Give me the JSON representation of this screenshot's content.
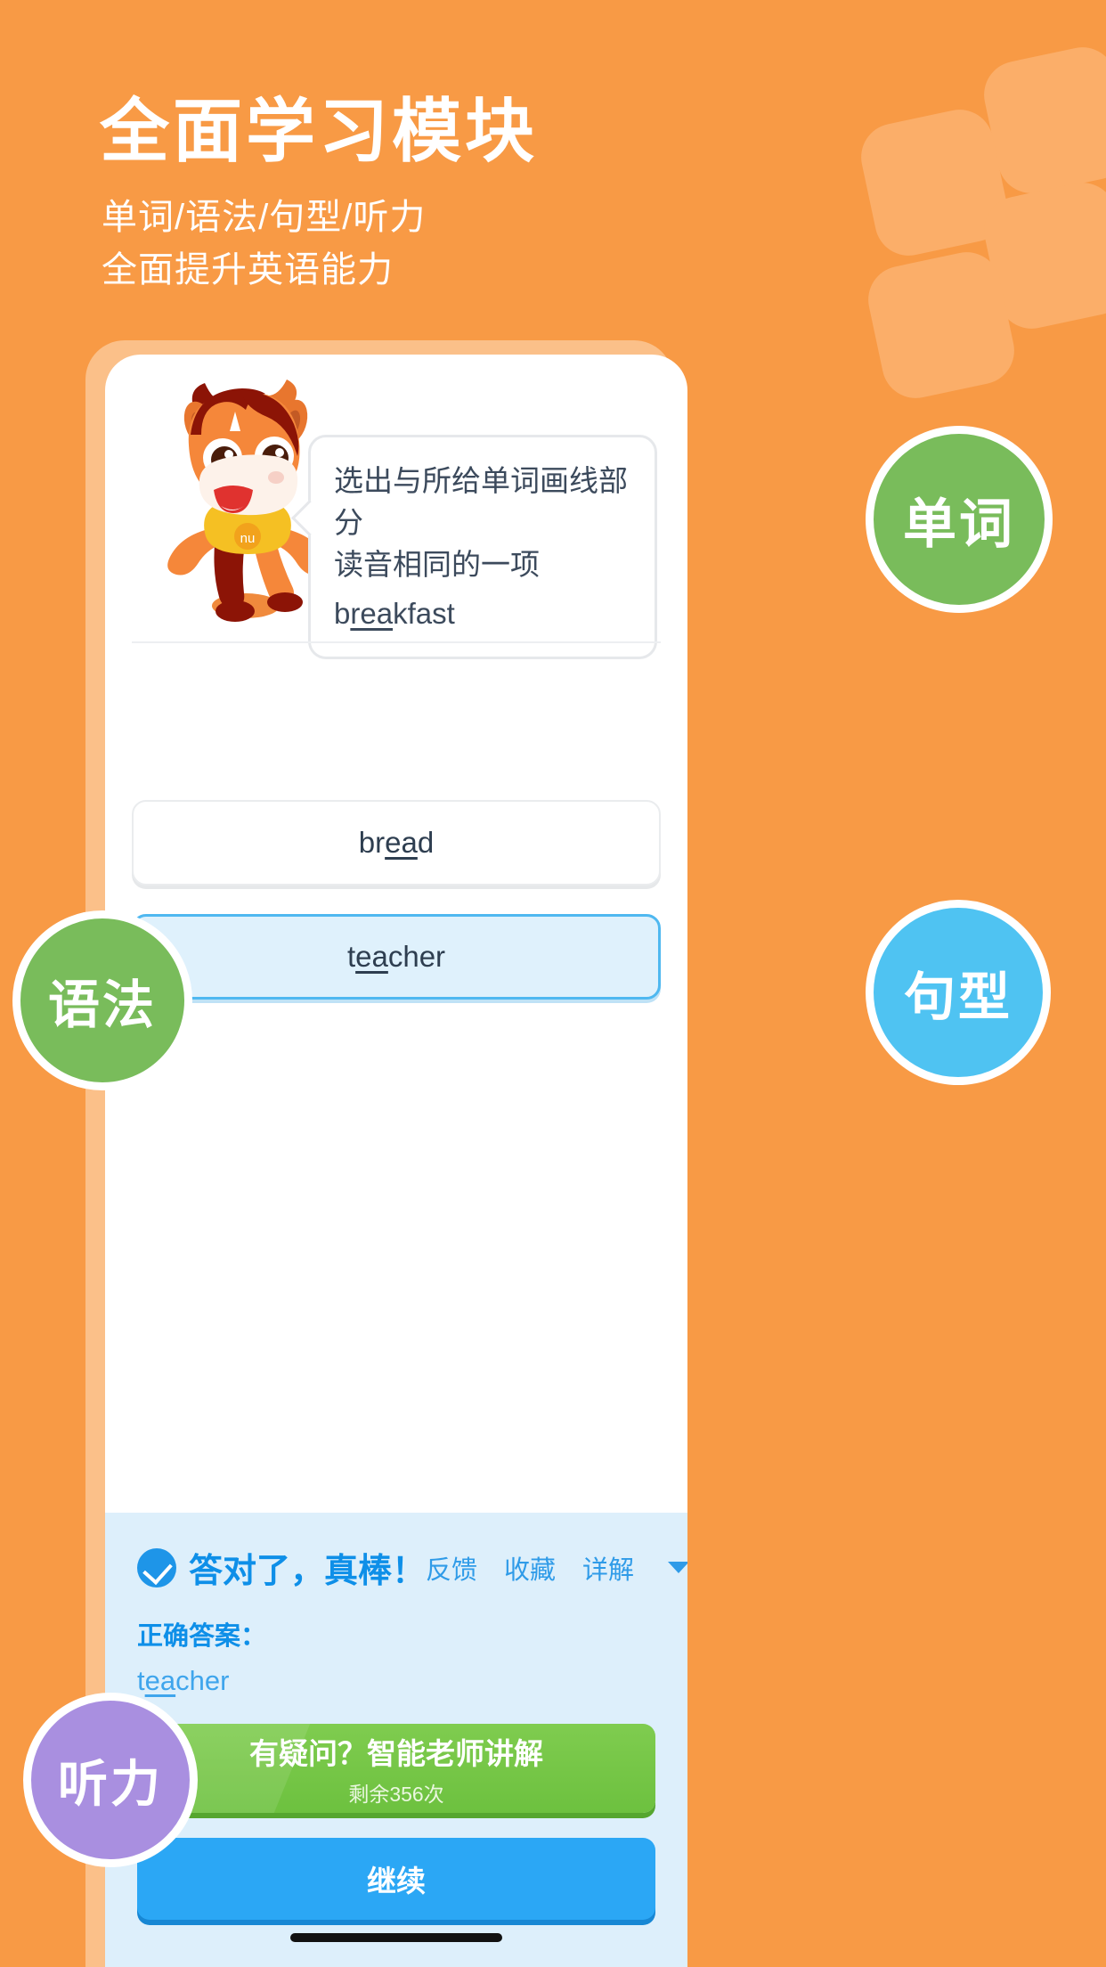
{
  "hero": {
    "title": "全面学习模块",
    "subtitle_lines": [
      "单词/语法/句型/听力",
      "全面提升英语能力"
    ]
  },
  "badges": [
    {
      "label": "单词",
      "color": "#79BC5B",
      "name": "badge-vocabulary"
    },
    {
      "label": "语法",
      "color": "#79BC5B",
      "name": "badge-grammar"
    },
    {
      "label": "句型",
      "color": "#4FC3F2",
      "name": "badge-sentence"
    },
    {
      "label": "听力",
      "color": "#A98FE0",
      "name": "badge-listening"
    }
  ],
  "question": {
    "prompt_line1": "选出与所给单词画线部分",
    "prompt_line2": "读音相同的一项",
    "word_prefix": "b",
    "word_underlined": "rea",
    "word_suffix": "kfast"
  },
  "options": [
    {
      "prefix": "br",
      "underlined": "ea",
      "suffix": "d",
      "selected": false
    },
    {
      "prefix": "t",
      "underlined": "ea",
      "suffix": "cher",
      "selected": true
    }
  ],
  "feedback": {
    "title": "答对了，真棒！",
    "actions": [
      "反馈",
      "收藏",
      "详解"
    ],
    "answer_label": "正确答案：",
    "answer_prefix": "t",
    "answer_underlined": "ea",
    "answer_suffix": "cher",
    "green_button_main": "有疑问？智能老师讲解",
    "green_button_sub": "剩余356次",
    "continue_label": "继续"
  },
  "colors": {
    "background": "#F89A45",
    "accent_blue": "#2BA7F5",
    "accent_green": "#6DC13F",
    "panel_blue": "#DDEFFB"
  }
}
